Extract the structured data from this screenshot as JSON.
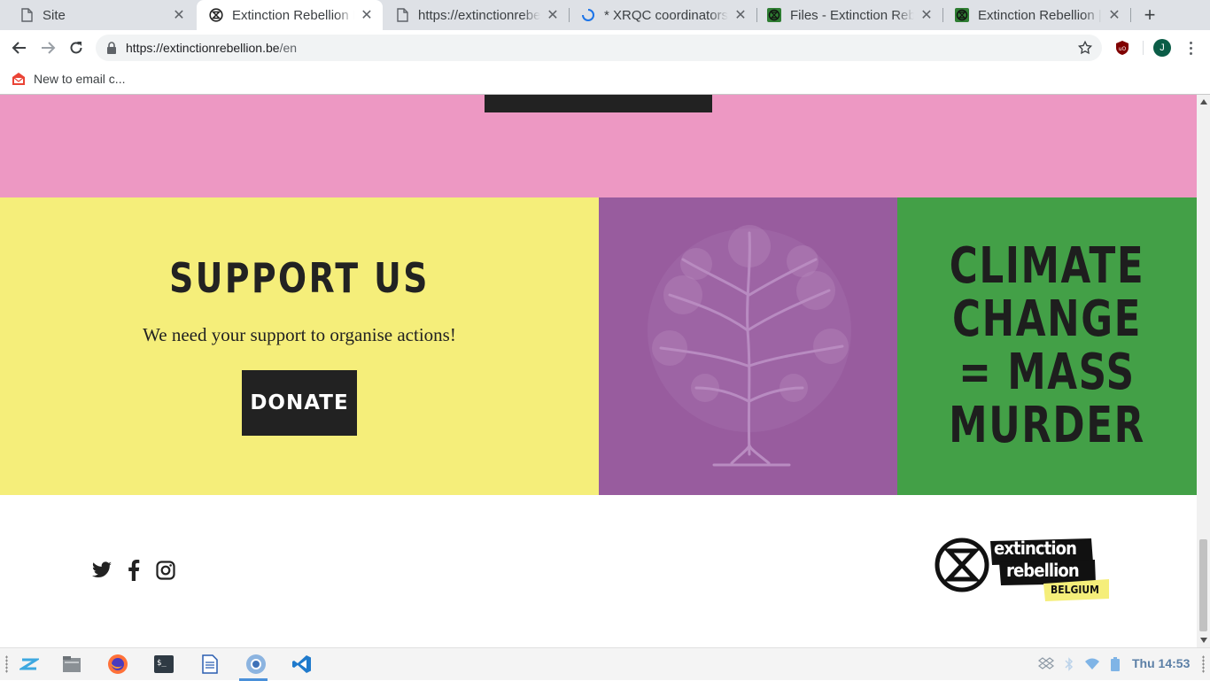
{
  "browser": {
    "tabs": [
      {
        "title": "Site",
        "favicon": "page-icon",
        "active": false
      },
      {
        "title": "Extinction Rebellion B",
        "favicon": "xr-logo-icon",
        "active": true
      },
      {
        "title": "https://extinctionrebel",
        "favicon": "page-icon",
        "active": false
      },
      {
        "title": "* XRQC coordinators -",
        "favicon": "loading-spinner-icon",
        "active": false
      },
      {
        "title": "Files - Extinction Rebe",
        "favicon": "xr-green-icon",
        "active": false
      },
      {
        "title": "Extinction Rebellion |",
        "favicon": "xr-green-icon",
        "active": false
      }
    ],
    "address_bar": {
      "url_host": "https://extinctionrebellion.be",
      "url_path": "/en"
    },
    "avatar_letter": "J",
    "bookmarks": [
      {
        "label": "New to email c...",
        "icon": "email-icon"
      }
    ]
  },
  "page": {
    "support": {
      "heading": "SUPPORT US",
      "text": "We need your support to organise actions!",
      "donate_label": "DONATE"
    },
    "slogan_lines": [
      "CLIMATE",
      "CHANGE",
      "= MASS",
      "MURDER"
    ],
    "footer": {
      "social": [
        "twitter-icon",
        "facebook-icon",
        "instagram-icon"
      ],
      "logo_line1": "extinction",
      "logo_line2": "rebellion",
      "logo_tag": "BELGIUM"
    },
    "colors": {
      "pink": "#ed98c3",
      "yellow": "#f5ee7a",
      "purple": "#985c9e",
      "green": "#43a047",
      "dark": "#222222"
    }
  },
  "taskbar": {
    "apps": [
      "zorin-menu-icon",
      "files-icon",
      "firefox-icon",
      "terminal-icon",
      "document-icon",
      "chromium-icon",
      "vscode-icon"
    ],
    "clock": "Thu 14:53"
  }
}
